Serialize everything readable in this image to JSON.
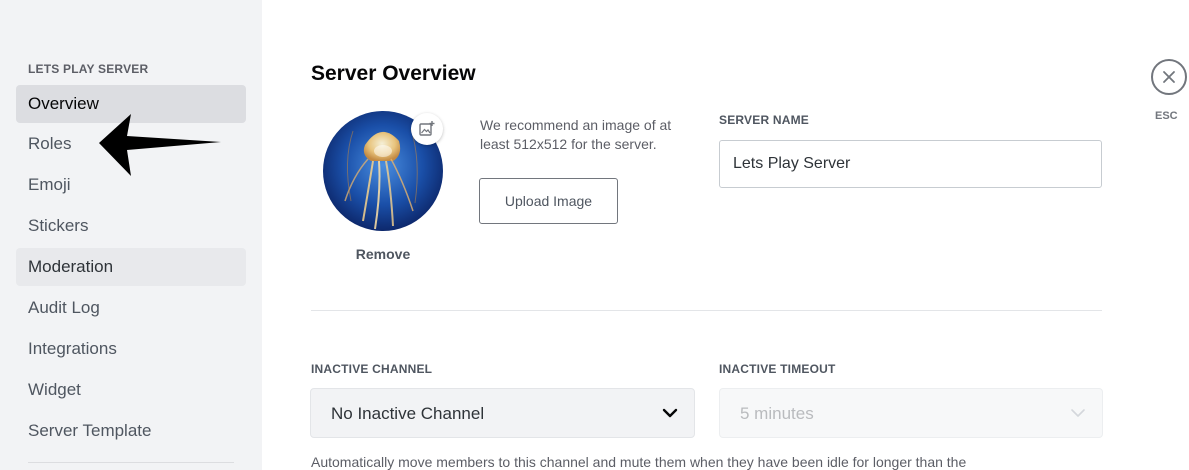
{
  "sidebar": {
    "header": "LETS PLAY SERVER",
    "items": [
      {
        "label": "Overview"
      },
      {
        "label": "Roles"
      },
      {
        "label": "Emoji"
      },
      {
        "label": "Stickers"
      },
      {
        "label": "Moderation"
      },
      {
        "label": "Audit Log"
      },
      {
        "label": "Integrations"
      },
      {
        "label": "Widget"
      },
      {
        "label": "Server Template"
      }
    ],
    "selected": "Overview"
  },
  "main": {
    "title": "Server Overview",
    "icon": {
      "recommendation": "We recommend an image of at least 512x512 for the server.",
      "upload_label": "Upload Image",
      "remove_label": "Remove"
    },
    "server_name": {
      "label": "SERVER NAME",
      "value": "Lets Play Server"
    },
    "inactive_channel": {
      "label": "INACTIVE CHANNEL",
      "value": "No Inactive Channel"
    },
    "inactive_timeout": {
      "label": "INACTIVE TIMEOUT",
      "value": "5 minutes"
    },
    "inactive_description": "Automatically move members to this channel and mute them when they have been idle for longer than the"
  },
  "close": {
    "esc_label": "ESC"
  },
  "colors": {
    "sidebar_bg": "#f2f3f5",
    "selected_bg": "#dcdde1",
    "text_primary": "#060607",
    "annotation_arrow": "#000000"
  }
}
